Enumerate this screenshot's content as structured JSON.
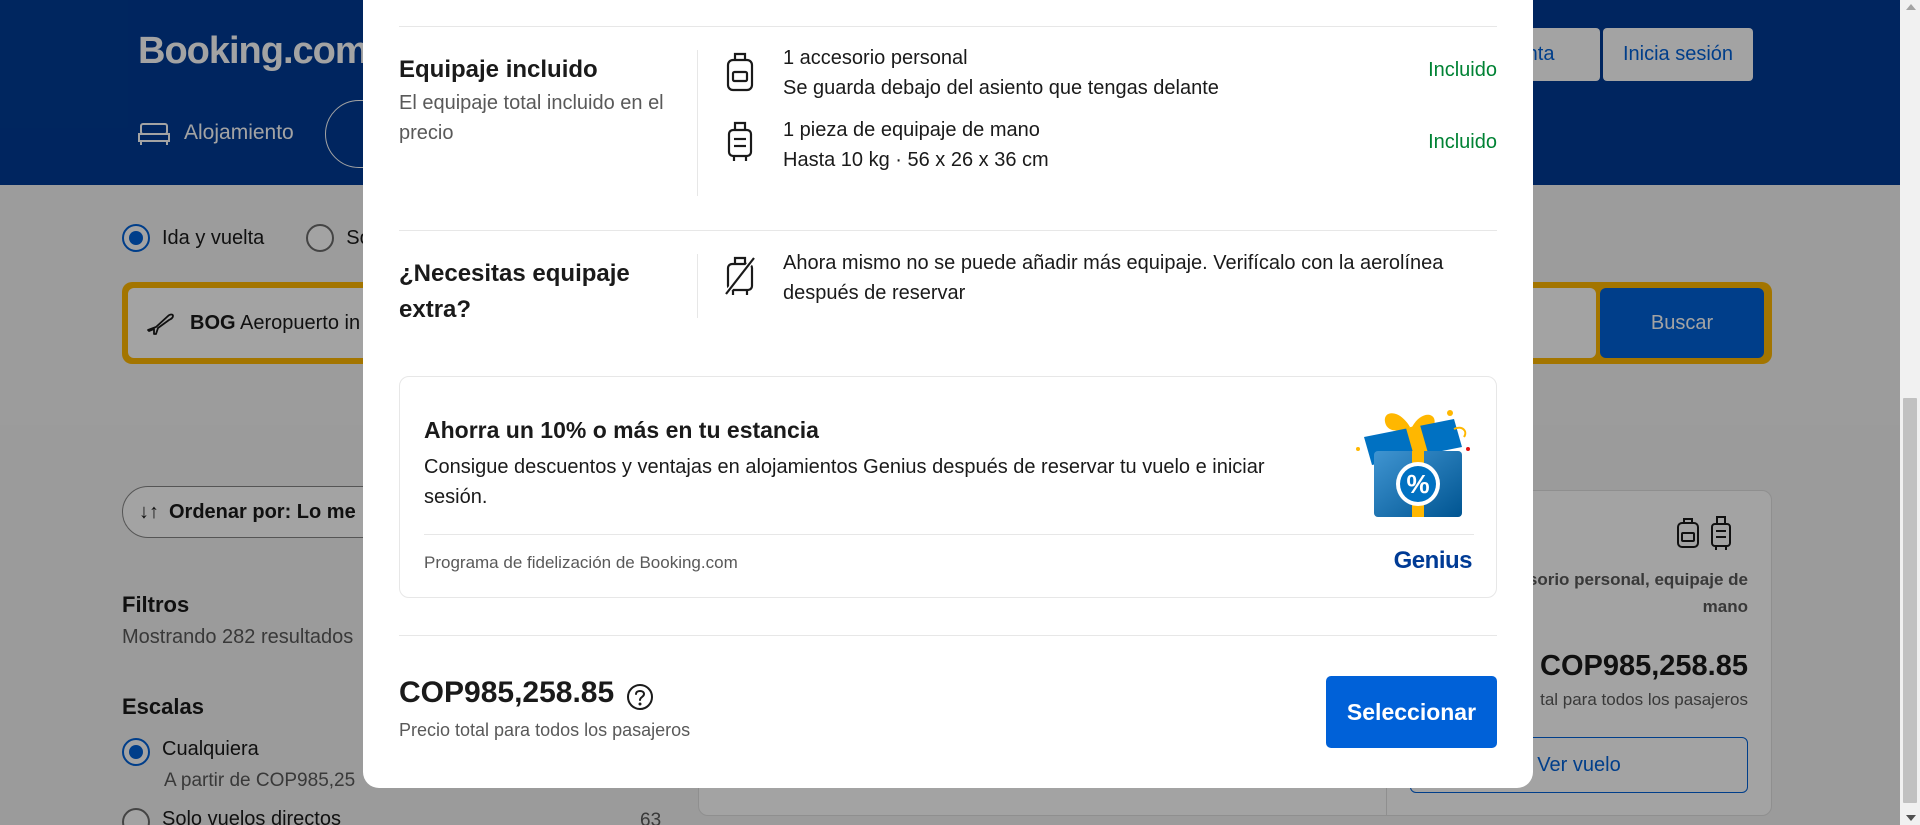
{
  "background": {
    "logo": "Booking.com",
    "header_buttons": {
      "register_partial": "enta",
      "signin": "Inicia sesión"
    },
    "nav": {
      "stays": "Alojamiento"
    },
    "trip_type": {
      "round_trip": "Ida y vuelta",
      "one_way_partial": "Sol"
    },
    "search": {
      "origin_code": "BOG",
      "origin_name_partial": "Aeropuerto in",
      "search_button": "Buscar"
    },
    "sort": {
      "label_partial": "Ordenar por: Lo me"
    },
    "filters": {
      "title": "Filtros",
      "count_partial": "Mostrando 282 resultados"
    },
    "stops": {
      "title": "Escalas",
      "any_label": "Cualquiera",
      "any_sub_partial": "A partir de COP985,25",
      "direct_label_partial": "Solo vuelos directos",
      "direct_count_partial": "63"
    },
    "card": {
      "bags_text_partial": "sorio personal, equipaje de mano",
      "price": "COP985,258.85",
      "price_sub_partial": "tal para todos los pasajeros",
      "button_partial": "Ver vuelo"
    }
  },
  "modal": {
    "included_section": {
      "title": "Equipaje incluido",
      "subtitle": "El equipaje total incluido en el precio",
      "items": [
        {
          "icon": "personal-item-icon",
          "line1": "1 accesorio personal",
          "line2": "Se guarda debajo del asiento que tengas delante",
          "status": "Incluido"
        },
        {
          "icon": "carry-on-icon",
          "line1": "1 pieza de equipaje de mano",
          "line2": "Hasta 10 kg · 56 x 26 x 36 cm",
          "status": "Incluido"
        }
      ]
    },
    "extra_section": {
      "title": "¿Necesitas equipaje extra?",
      "text": "Ahora mismo no se puede añadir más equipaje. Verifícalo con la aerolínea después de reservar"
    },
    "promo": {
      "title": "Ahorra un 10% o más en tu estancia",
      "text": "Consigue descuentos y ventajas en alojamientos Genius después de reservar tu vuelo e iniciar sesión.",
      "footer": "Programa de fidelización de Booking.com",
      "brand": "Genius",
      "gift_symbol": "%"
    },
    "footer": {
      "price": "COP985,258.85",
      "price_sub": "Precio total para todos los pasajeros",
      "select_button": "Seleccionar"
    }
  },
  "colors": {
    "brand_blue": "#003b95",
    "action_blue": "#0061d8",
    "included_green": "#008234",
    "search_yellow": "#ffb700"
  }
}
